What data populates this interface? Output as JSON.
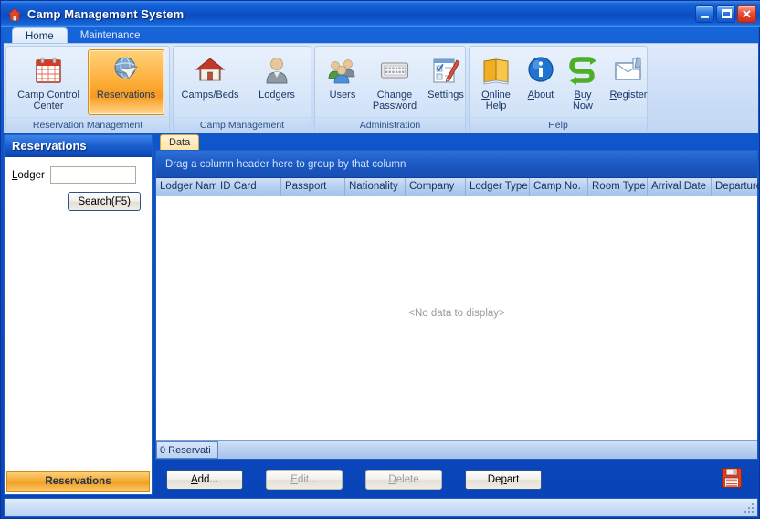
{
  "window": {
    "title": "Camp Management System",
    "icon": "house-icon",
    "controls": [
      {
        "name": "minimize",
        "glyph": "_"
      },
      {
        "name": "maximize",
        "glyph": "□"
      },
      {
        "name": "close",
        "glyph": "✕"
      }
    ]
  },
  "ribbon": {
    "tabs": [
      {
        "label": "Home",
        "active": true
      },
      {
        "label": "Maintenance",
        "active": false
      }
    ],
    "groups": [
      {
        "label": "Reservation Management",
        "width": 180,
        "items": [
          {
            "label": "Camp Control Center",
            "icon": "calendar-icon",
            "selected": false,
            "accel": ""
          },
          {
            "label": "Reservations",
            "icon": "globe-arrow-icon",
            "selected": true,
            "accel": ""
          }
        ]
      },
      {
        "label": "Camp Management",
        "width": 152,
        "items": [
          {
            "label": "Camps/Beds",
            "icon": "house-icon",
            "selected": false,
            "accel": ""
          },
          {
            "label": "Lodgers",
            "icon": "person-icon",
            "selected": false,
            "accel": ""
          }
        ]
      },
      {
        "label": "Administration",
        "width": 166,
        "items": [
          {
            "label": "Users",
            "icon": "users-group-icon",
            "selected": false,
            "accel": ""
          },
          {
            "label": "Change Password",
            "icon": "keyboard-icon",
            "selected": false,
            "accel": ""
          },
          {
            "label": "Settings",
            "icon": "checklist-pen-icon",
            "selected": false,
            "accel": ""
          }
        ]
      },
      {
        "label": "Help",
        "width": 196,
        "items": [
          {
            "label": "Online Help",
            "icon": "book-icon",
            "selected": false,
            "accel": "O"
          },
          {
            "label": "About",
            "icon": "info-circle-icon",
            "selected": false,
            "accel": "A"
          },
          {
            "label": "Buy Now",
            "icon": "green-arrows-icon",
            "selected": false,
            "accel": "B"
          },
          {
            "label": "Register",
            "icon": "envelope-pen-icon",
            "selected": false,
            "accel": "R"
          }
        ]
      }
    ]
  },
  "sidebar": {
    "header": "Reservations",
    "lodger_label": "Lodger",
    "lodger_accel": "L",
    "lodger_value": "",
    "lodger_placeholder": "",
    "search_label": "Search(F5)",
    "footer_label": "Reservations"
  },
  "main": {
    "doc_tabs": [
      {
        "label": "Data",
        "active": true
      }
    ],
    "group_panel_text": "Drag a column header here to group by that column",
    "columns": [
      {
        "label": "Lodger Name",
        "width": 66
      },
      {
        "label": "ID Card",
        "width": 71
      },
      {
        "label": "Passport",
        "width": 70
      },
      {
        "label": "Nationality",
        "width": 66
      },
      {
        "label": "Company",
        "width": 66
      },
      {
        "label": "Lodger Type",
        "width": 70
      },
      {
        "label": "Camp No.",
        "width": 64
      },
      {
        "label": "Room Type",
        "width": 65
      },
      {
        "label": "Arrival Date",
        "width": 70
      },
      {
        "label": "Departure D..",
        "width": 70
      }
    ],
    "empty_text": "<No data to display>",
    "footer_count": "0 Reservati",
    "buttons": [
      {
        "label": "Add...",
        "accel": "A",
        "enabled": true,
        "default": true
      },
      {
        "label": "Edit...",
        "accel": "E",
        "enabled": false,
        "default": false
      },
      {
        "label": "Delete",
        "accel": "D",
        "enabled": false,
        "default": false
      },
      {
        "label": "Depart",
        "accel": "p",
        "enabled": true,
        "default": true
      }
    ],
    "save_icon": "floppy-save-icon"
  },
  "statusbar": {
    "text": "",
    "grip": "resize-grip-icon"
  },
  "colors": {
    "titlebar_blue": "#0b4cc2",
    "accent_orange": "#f6ab33",
    "grid_header_blue": "#b6cef0",
    "group_panel_blue": "#1c59c2",
    "ribbon_bg": "#cfe0f7"
  }
}
